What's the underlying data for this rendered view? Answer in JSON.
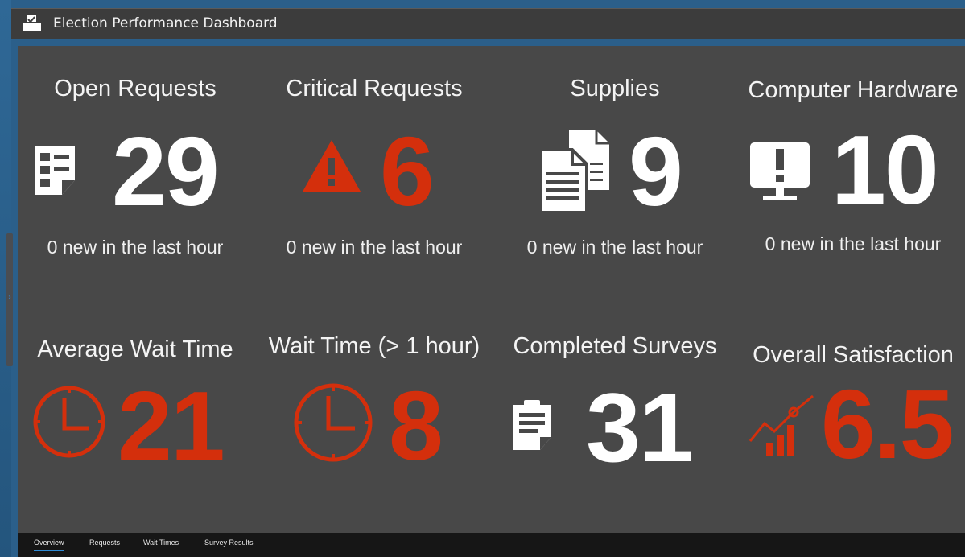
{
  "app": {
    "title": "Election Performance Dashboard",
    "logo_icon": "ballot-box-icon"
  },
  "colors": {
    "panel": "#484848",
    "titlebar": "#3c3c3c",
    "value_white": "#ffffff",
    "value_red": "#d42f0c",
    "tab_active_underline": "#2e8bd6"
  },
  "cards": [
    {
      "title": "Open Requests",
      "value": "29",
      "subtitle": "0 new in the last hour",
      "icon": "request-form-icon",
      "value_color": "#ffffff"
    },
    {
      "title": "Critical Requests",
      "value": "6",
      "subtitle": "0 new in the last hour",
      "icon": "warning-triangle-icon",
      "value_color": "#d42f0c"
    },
    {
      "title": "Supplies",
      "value": "9",
      "subtitle": "0 new in the last hour",
      "icon": "documents-icon",
      "value_color": "#ffffff"
    },
    {
      "title": "Computer Hardware",
      "value": "10",
      "subtitle": "0 new in the last hour",
      "icon": "monitor-alert-icon",
      "value_color": "#ffffff"
    },
    {
      "title": "Average Wait Time",
      "value": "21",
      "icon": "clock-icon",
      "value_color": "#d42f0c"
    },
    {
      "title": "Wait Time (> 1 hour)",
      "value": "8",
      "icon": "clock-icon",
      "value_color": "#d42f0c"
    },
    {
      "title": "Completed Surveys",
      "value": "31",
      "icon": "clipboard-icon",
      "value_color": "#ffffff"
    },
    {
      "title": "Overall Satisfaction",
      "value": "6.5",
      "icon": "trend-chart-icon",
      "value_color": "#d42f0c"
    }
  ],
  "tabs": [
    {
      "label": "Overview",
      "active": true
    },
    {
      "label": "Requests",
      "active": false
    },
    {
      "label": "Wait Times",
      "active": false
    },
    {
      "label": "Survey Results",
      "active": false
    }
  ]
}
